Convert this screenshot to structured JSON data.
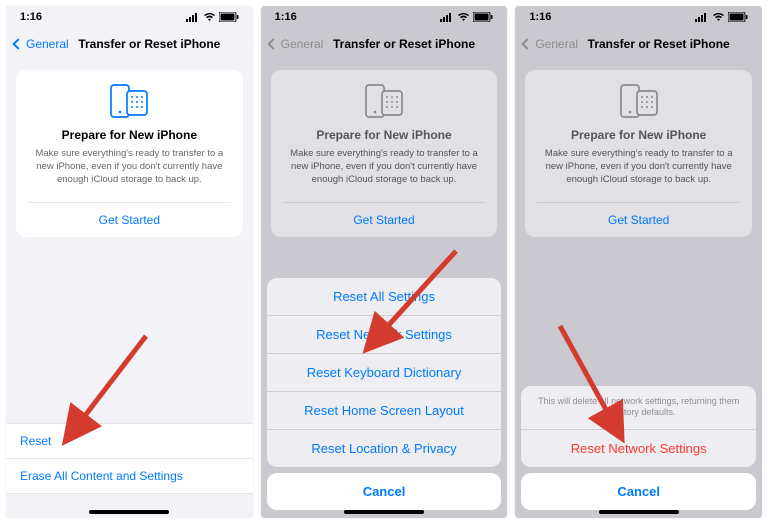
{
  "status": {
    "time": "1:16",
    "signal": "●●●●",
    "wifi": "wifi",
    "battery": "full"
  },
  "nav": {
    "back": "General",
    "title": "Transfer or Reset iPhone"
  },
  "card": {
    "title": "Prepare for New iPhone",
    "desc": "Make sure everything's ready to transfer to a new iPhone, even if you don't currently have enough iCloud storage to back up.",
    "button": "Get Started"
  },
  "bottom": {
    "reset": "Reset",
    "erase": "Erase All Content and Settings"
  },
  "sheet2": {
    "options": [
      "Reset All Settings",
      "Reset Network Settings",
      "Reset Keyboard Dictionary",
      "Reset Home Screen Layout",
      "Reset Location & Privacy"
    ],
    "cancel": "Cancel"
  },
  "sheet3": {
    "message": "This will delete all network settings, returning them to factory defaults.",
    "action": "Reset Network Settings",
    "cancel": "Cancel"
  }
}
